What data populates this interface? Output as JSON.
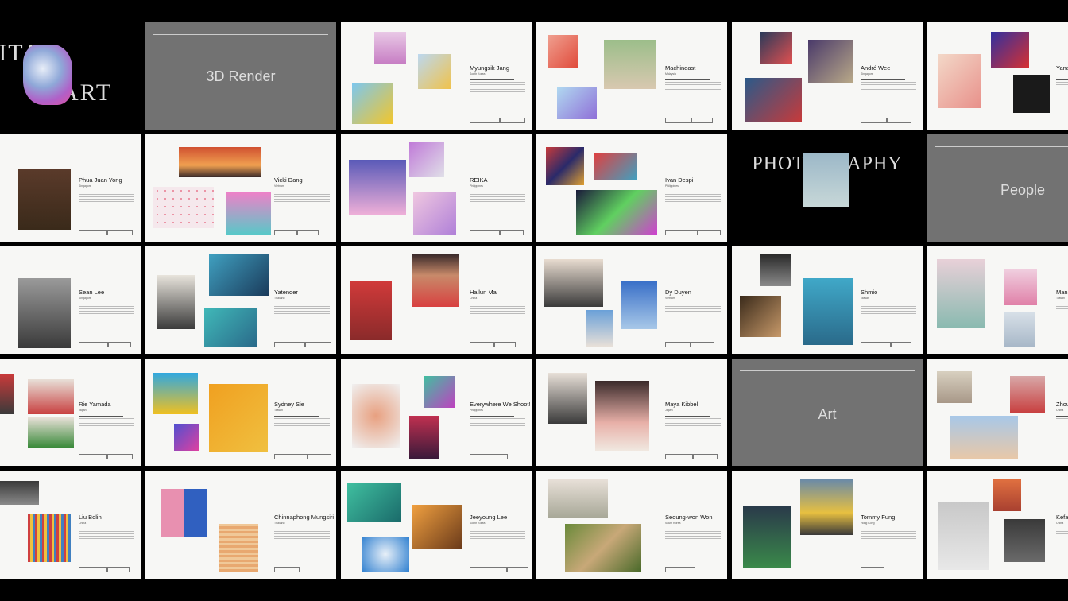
{
  "colors": {
    "background": "#000000",
    "slide": "#f7f7f5",
    "section": "#727272"
  },
  "sections": {
    "render": "3D Render",
    "people": "People",
    "art": "Art",
    "photography": "PHOTOGRAPHY",
    "digital_a": "DIGITAL",
    "digital_b": "ART"
  },
  "artists": [
    {
      "name": "Myungsik Jang",
      "country": "South Korea"
    },
    {
      "name": "Machineast",
      "country": "Malaysia"
    },
    {
      "name": "André Wee",
      "country": "Singapore"
    },
    {
      "name": "Yana",
      "country": ""
    },
    {
      "name": "Phua Juan Yong",
      "country": "Singapore"
    },
    {
      "name": "Vicki Dang",
      "country": "Vietnam"
    },
    {
      "name": "REIKA",
      "country": "Philippines"
    },
    {
      "name": "Ivan Despi",
      "country": "Philippines"
    },
    {
      "name": "Sean Lee",
      "country": "Singapore"
    },
    {
      "name": "Yatender",
      "country": "Thailand"
    },
    {
      "name": "Hailun Ma",
      "country": "China"
    },
    {
      "name": "Dy Duyen",
      "country": "Vietnam"
    },
    {
      "name": "Shmio",
      "country": "Taiwan"
    },
    {
      "name": "Mani",
      "country": "Taiwan"
    },
    {
      "name": "Rie Yamada",
      "country": "Japan"
    },
    {
      "name": "Sydney Sie",
      "country": "Taiwan"
    },
    {
      "name": "Everywhere We Shoot!",
      "country": "Philippines"
    },
    {
      "name": "Maya Kibbel",
      "country": "Japan"
    },
    {
      "name": "Zhou",
      "country": "China"
    },
    {
      "name": "Liu Bolin",
      "country": "China"
    },
    {
      "name": "Chinnaphong Mungsiri",
      "country": "Thailand"
    },
    {
      "name": "Jeeyoung Lee",
      "country": "South Korea"
    },
    {
      "name": "Seoung-won Won",
      "country": "South Korea"
    },
    {
      "name": "Tommy Fung",
      "country": "Hong Kong"
    },
    {
      "name": "Kefa",
      "country": "China"
    }
  ]
}
